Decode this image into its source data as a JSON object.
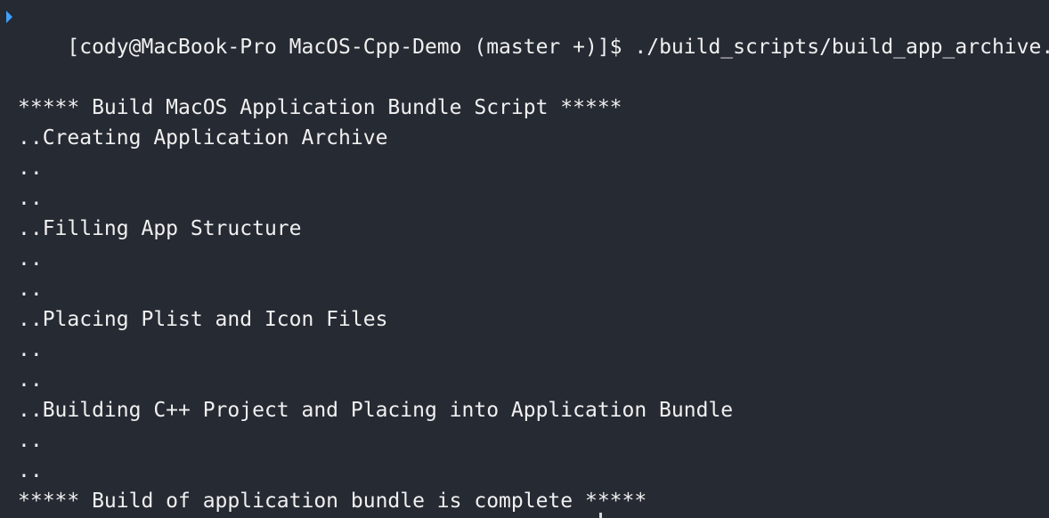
{
  "terminal": {
    "prompt": "[cody@MacBook-Pro MacOS-Cpp-Demo (master +)]$",
    "command": "./build_scripts/build_app_archive.sh",
    "output_lines": [
      "***** Build MacOS Application Bundle Script *****",
      "..Creating Application Archive",
      "..",
      "..",
      "..Filling App Structure",
      "..",
      "..",
      "..Placing Plist and Icon Files",
      "..",
      "..",
      "..Building C++ Project and Placing into Application Bundle",
      "..",
      "..",
      "***** Build of application bundle is complete *****"
    ]
  },
  "colors": {
    "background": "#262a33",
    "text": "#f0f0f0",
    "prompt_marker": "#3ea0ff"
  }
}
